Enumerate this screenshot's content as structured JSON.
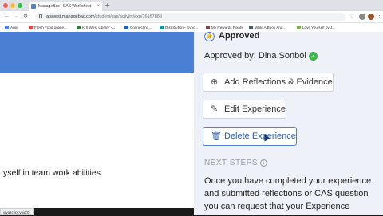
{
  "browser": {
    "tab_title": "ManageBac | CAS Worksheet",
    "tab_close": "×",
    "new_tab": "+",
    "url_host": "aiswest.managebac.com",
    "url_path": "/student/cas/activity/exp/16167889",
    "bookmarks": [
      "Apps",
      "Fresh Food online...",
      "KIS West Library -...",
      "Connecting...",
      "Distribution - Sync...",
      "My Rewards Points",
      "Write A Book And...",
      "Love Yourself by J..."
    ],
    "colors": {
      "tab_bar": "#dee1e6",
      "banner": "#4a7fd4"
    }
  },
  "left": {
    "text": "yself in team work abilities."
  },
  "right": {
    "approved_title": "Approved",
    "approved_by": "Approved by: Dina Sonbol",
    "buttons": {
      "add_reflections": "Add Reflections & Evidence",
      "edit": "Edit Experience",
      "delete": "Delete Experience"
    },
    "next_steps_heading": "NEXT STEPS",
    "next_steps_lines": [
      "Once you have completed your experience",
      "and submitted reflections or CAS question",
      "you can request that your Experience"
    ]
  },
  "status_bar": "javascript:void(0)",
  "icons": [
    "thumbs-up-icon",
    "check-icon",
    "plus-circle-icon",
    "pencil-icon",
    "trash-icon",
    "info-icon"
  ],
  "accent": "#4a7fd4",
  "success": "#3ab54a"
}
